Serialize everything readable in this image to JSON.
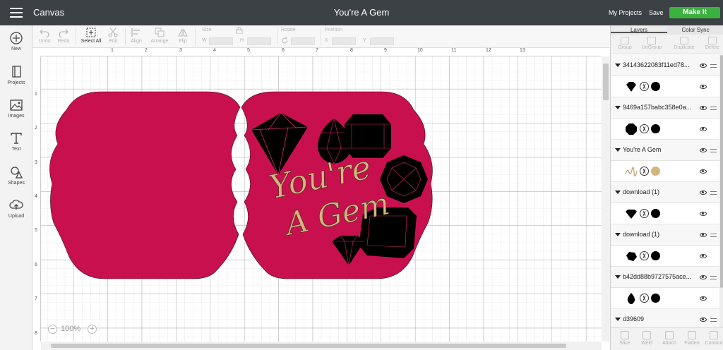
{
  "header": {
    "app_title": "Canvas",
    "document_title": "You're A Gem",
    "my_projects": "My Projects",
    "save": "Save",
    "make_it": "Make It",
    "colors": {
      "bar": "#3c4146",
      "make_it": "#3bb13f"
    }
  },
  "left_tools": [
    {
      "label": "New",
      "icon": "plus-circle-icon"
    },
    {
      "label": "Projects",
      "icon": "book-icon"
    },
    {
      "label": "Images",
      "icon": "image-icon"
    },
    {
      "label": "Text",
      "icon": "text-t-icon"
    },
    {
      "label": "Shapes",
      "icon": "shapes-icon"
    },
    {
      "label": "Upload",
      "icon": "cloud-upload-icon"
    }
  ],
  "toolbar": {
    "undo": "Undo",
    "redo": "Redo",
    "select_all": "Select All",
    "edit": "Edit",
    "align": "Align",
    "arrange": "Arrange",
    "flip": "Flip",
    "size": "Size",
    "w": "W",
    "h": "H",
    "rotate": "Rotate",
    "position": "Position",
    "x": "X",
    "y": "Y"
  },
  "canvas": {
    "ruler_top": [
      "1",
      "2",
      "3",
      "4",
      "5",
      "6",
      "7",
      "8",
      "9",
      "10",
      "11",
      "12",
      "13"
    ],
    "ruler_left": [
      "1",
      "2",
      "3",
      "4",
      "5",
      "6",
      "7",
      "8"
    ],
    "zoom_level": "100%",
    "zoom_minus": "−",
    "zoom_plus": "+",
    "card_color": "#c8104e",
    "text_color": "#d4b483",
    "sentiment_line1": "You're",
    "sentiment_line2": "A Gem"
  },
  "panel": {
    "tabs": [
      "Layers",
      "Color Sync"
    ],
    "actions": [
      "Group",
      "UnGroup",
      "Duplicate",
      "Delete"
    ],
    "groups": [
      {
        "name": "34143622083f11ed78...",
        "swatch": "#000000",
        "thumb": "gem-thumb-icon"
      },
      {
        "name": "9469a157babc358e0a...",
        "swatch": "#000000",
        "thumb": "octagon-gem-thumb-icon"
      },
      {
        "name": "You're A Gem",
        "swatch": "#d4b483",
        "thumb": "script-text-thumb-icon"
      },
      {
        "name": "download (1)",
        "swatch": "#000000",
        "thumb": "diamond-thumb-icon"
      },
      {
        "name": "download (1)",
        "swatch": "#000000",
        "thumb": "cluster-gem-thumb-icon"
      },
      {
        "name": "b42dd88b9727575ace...",
        "swatch": "#000000",
        "thumb": "drop-gem-thumb-icon"
      },
      {
        "name": "d39609",
        "swatch": "",
        "thumb": ""
      }
    ],
    "bottom_actions": [
      "Slice",
      "Weld",
      "Attach",
      "Flatten",
      "Contour"
    ]
  }
}
